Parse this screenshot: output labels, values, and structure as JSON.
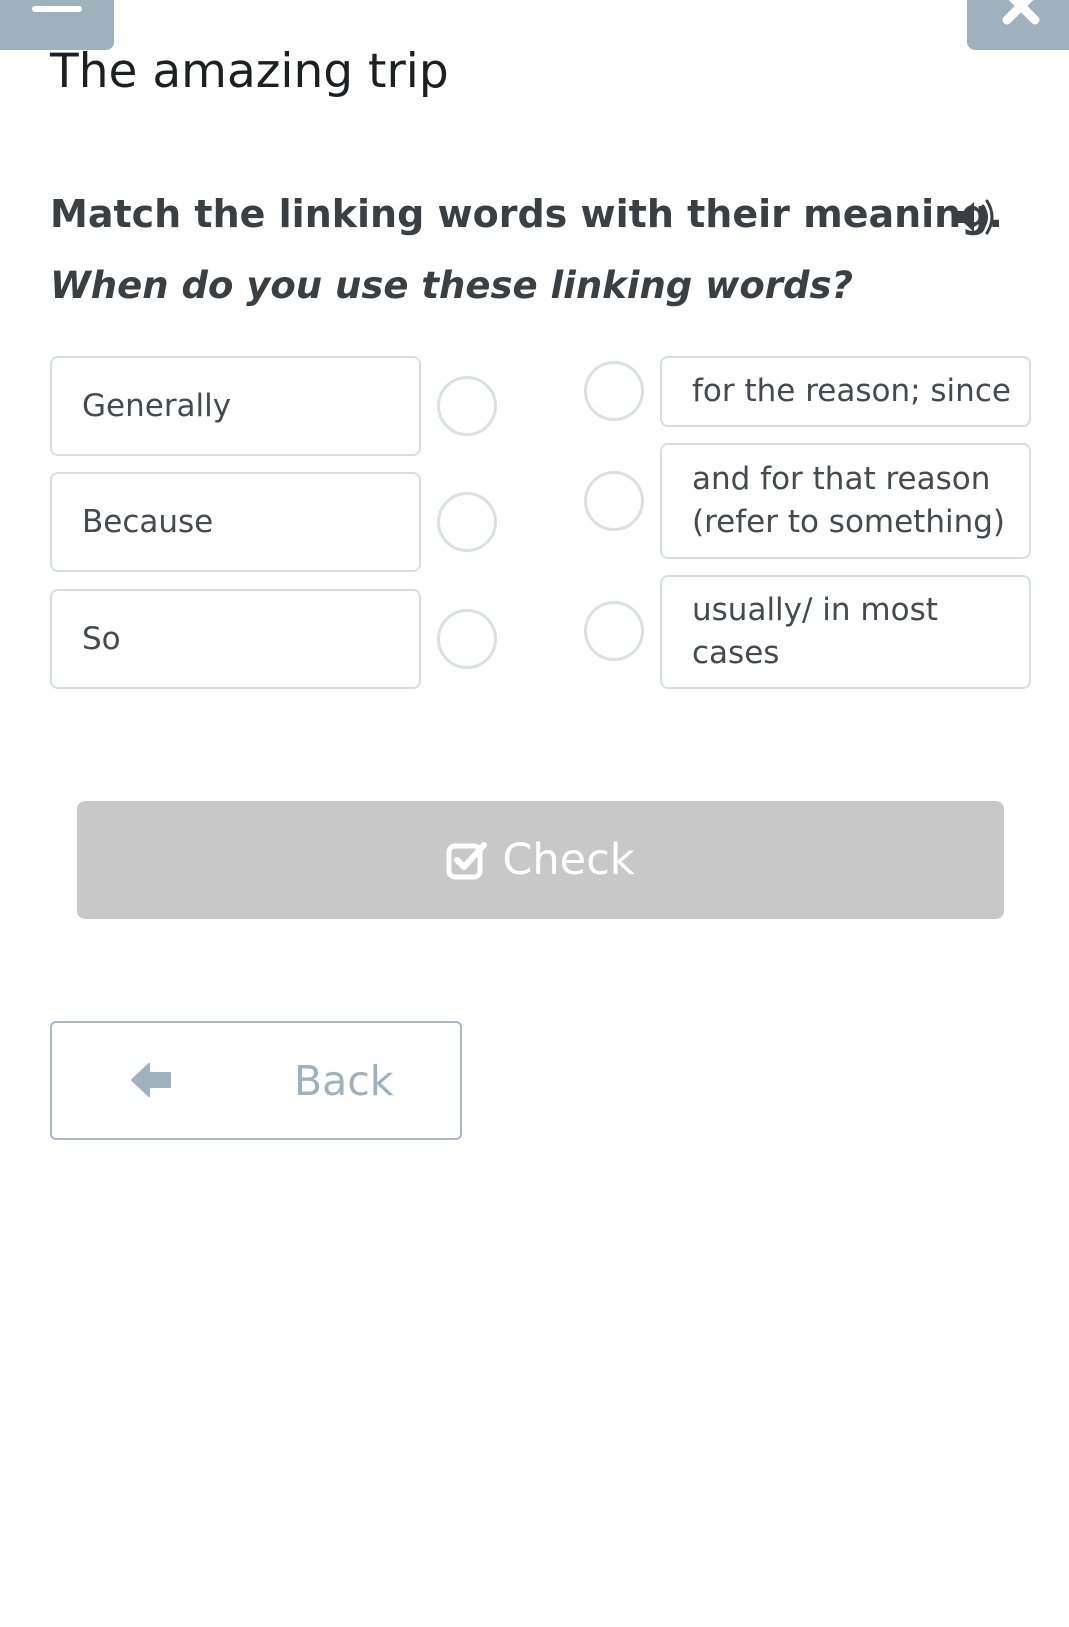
{
  "header": {
    "menu_icon": "hamburger-icon",
    "close_icon": "close-icon"
  },
  "exercise": {
    "title": "The amazing trip",
    "instruction": "Match the linking words with their meaning.",
    "sound_icon": "speaker-icon",
    "question": "When do you use these linking words?"
  },
  "left_items": [
    {
      "label": "Generally"
    },
    {
      "label": "Because"
    },
    {
      "label": "So"
    }
  ],
  "right_items": [
    {
      "label": "for the reason; since"
    },
    {
      "label": "and for that reason (refer to something)"
    },
    {
      "label": "usually/ in most cases"
    }
  ],
  "buttons": {
    "check_label": "Check",
    "check_icon": "checkbox-checked-icon",
    "back_label": "Back",
    "back_icon": "arrow-left-icon"
  },
  "colors": {
    "tab_bg": "#9fb1bc",
    "check_bg": "#c8c8c8",
    "card_border": "#d9dde1",
    "text": "#3a3f44"
  }
}
